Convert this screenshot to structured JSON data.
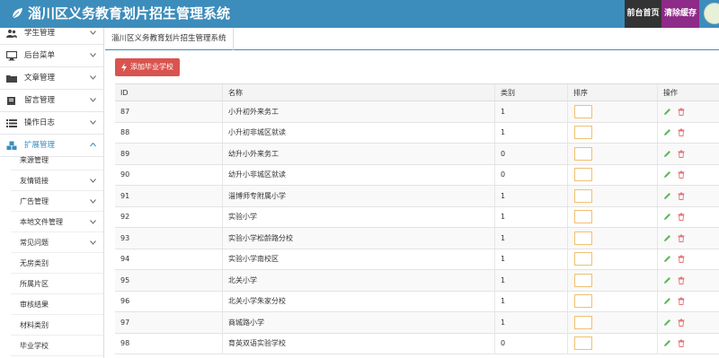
{
  "header": {
    "title": "淄川区义务教育划片招生管理系统",
    "home_label": "前台首页",
    "clear_cache_label": "清除缓存",
    "brand_color": "#3c8dbc"
  },
  "sidebar": {
    "items": [
      {
        "label": "学生管理",
        "icon": "users-icon"
      },
      {
        "label": "后台菜单",
        "icon": "monitor-icon"
      },
      {
        "label": "文章管理",
        "icon": "folder-icon"
      },
      {
        "label": "留言管理",
        "icon": "book-icon"
      },
      {
        "label": "操作日志",
        "icon": "list-icon"
      },
      {
        "label": "扩展管理",
        "icon": "cubes-icon"
      }
    ],
    "sub_items": [
      {
        "label": "来源管理"
      },
      {
        "label": "友情链接"
      },
      {
        "label": "广告管理"
      },
      {
        "label": "本地文件管理"
      },
      {
        "label": "常见问题"
      },
      {
        "label": "无房类别"
      },
      {
        "label": "所属片区"
      },
      {
        "label": "审核结果"
      },
      {
        "label": "材料类别"
      },
      {
        "label": "毕业学校"
      }
    ]
  },
  "tab": {
    "label": "淄川区义务教育划片招生管理系统"
  },
  "toolbar": {
    "add_label": "添加毕业学校"
  },
  "table": {
    "headers": [
      "ID",
      "名称",
      "类别",
      "排序",
      "操作"
    ],
    "rows": [
      {
        "id": "87",
        "name": "小升初外来务工",
        "category": "1"
      },
      {
        "id": "88",
        "name": "小升初非城区就读",
        "category": "1"
      },
      {
        "id": "89",
        "name": "幼升小外来务工",
        "category": "0"
      },
      {
        "id": "90",
        "name": "幼升小非城区就读",
        "category": "0"
      },
      {
        "id": "91",
        "name": "淄博师专附属小学",
        "category": "1"
      },
      {
        "id": "92",
        "name": "实验小学",
        "category": "1"
      },
      {
        "id": "93",
        "name": "实验小学松龄路分校",
        "category": "1"
      },
      {
        "id": "94",
        "name": "实验小学南校区",
        "category": "1"
      },
      {
        "id": "95",
        "name": "北关小学",
        "category": "1"
      },
      {
        "id": "96",
        "name": "北关小学朱家分校",
        "category": "1"
      },
      {
        "id": "97",
        "name": "商城路小学",
        "category": "1"
      },
      {
        "id": "98",
        "name": "育英双语实验学校",
        "category": "0"
      }
    ]
  }
}
